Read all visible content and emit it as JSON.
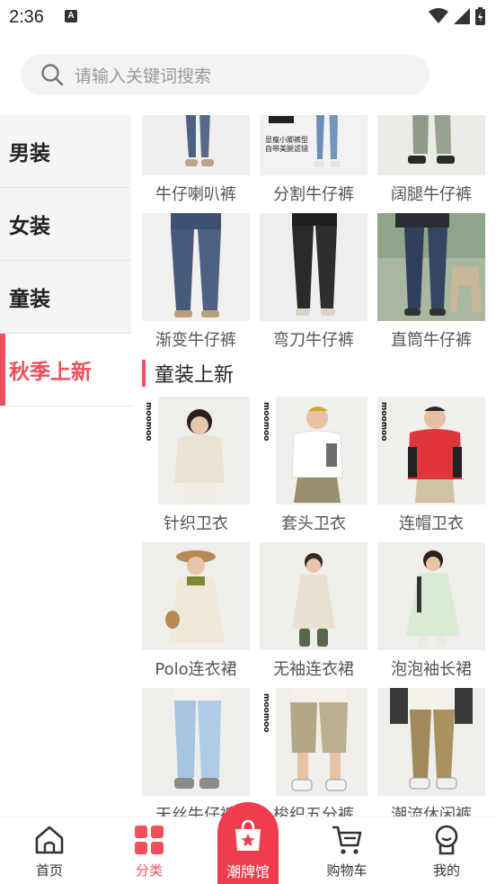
{
  "status_bar": {
    "time": "2:36",
    "notification_glyph": "A"
  },
  "search": {
    "placeholder": "请输入关键词搜索"
  },
  "sidebar": {
    "items": [
      {
        "label": "男装",
        "active": false
      },
      {
        "label": "女装",
        "active": false
      },
      {
        "label": "童装",
        "active": false
      },
      {
        "label": "秋季上新",
        "active": true
      }
    ]
  },
  "products_top": [
    {
      "label": "牛仔喇叭裤",
      "image_text": ""
    },
    {
      "label": "分割牛仔裤",
      "image_text": "显瘦小脚裤型\n自带美腿滤镜"
    },
    {
      "label": "阔腿牛仔裤",
      "image_text": ""
    },
    {
      "label": "渐变牛仔裤",
      "image_text": ""
    },
    {
      "label": "弯刀牛仔裤",
      "image_text": ""
    },
    {
      "label": "直筒牛仔裤",
      "image_text": ""
    }
  ],
  "section": {
    "title": "童装上新"
  },
  "products_kids": [
    {
      "label": "针织卫衣",
      "brand": "moomoo"
    },
    {
      "label": "套头卫衣",
      "brand": "moomoo"
    },
    {
      "label": "连帽卫衣",
      "brand": "moomoo"
    },
    {
      "label": "Polo连衣裙",
      "brand": ""
    },
    {
      "label": "无袖连衣裙",
      "brand": ""
    },
    {
      "label": "泡泡袖长裙",
      "brand": ""
    },
    {
      "label": "天丝牛仔裤",
      "brand": ""
    },
    {
      "label": "梭织五分裤",
      "brand": "moomoo"
    },
    {
      "label": "潮流休闲裤",
      "brand": ""
    }
  ],
  "bottom_nav": {
    "items": [
      {
        "label": "首页",
        "icon": "home-icon",
        "active": false
      },
      {
        "label": "分类",
        "icon": "category-icon",
        "active": true
      },
      {
        "label": "购物车",
        "icon": "cart-icon",
        "active": false
      },
      {
        "label": "我的",
        "icon": "profile-icon",
        "active": false
      }
    ],
    "center": {
      "label": "潮牌馆",
      "icon": "shopping-bag-star-icon"
    }
  },
  "colors": {
    "accent": "#f24e5b",
    "center_button": "#f03d4e"
  }
}
